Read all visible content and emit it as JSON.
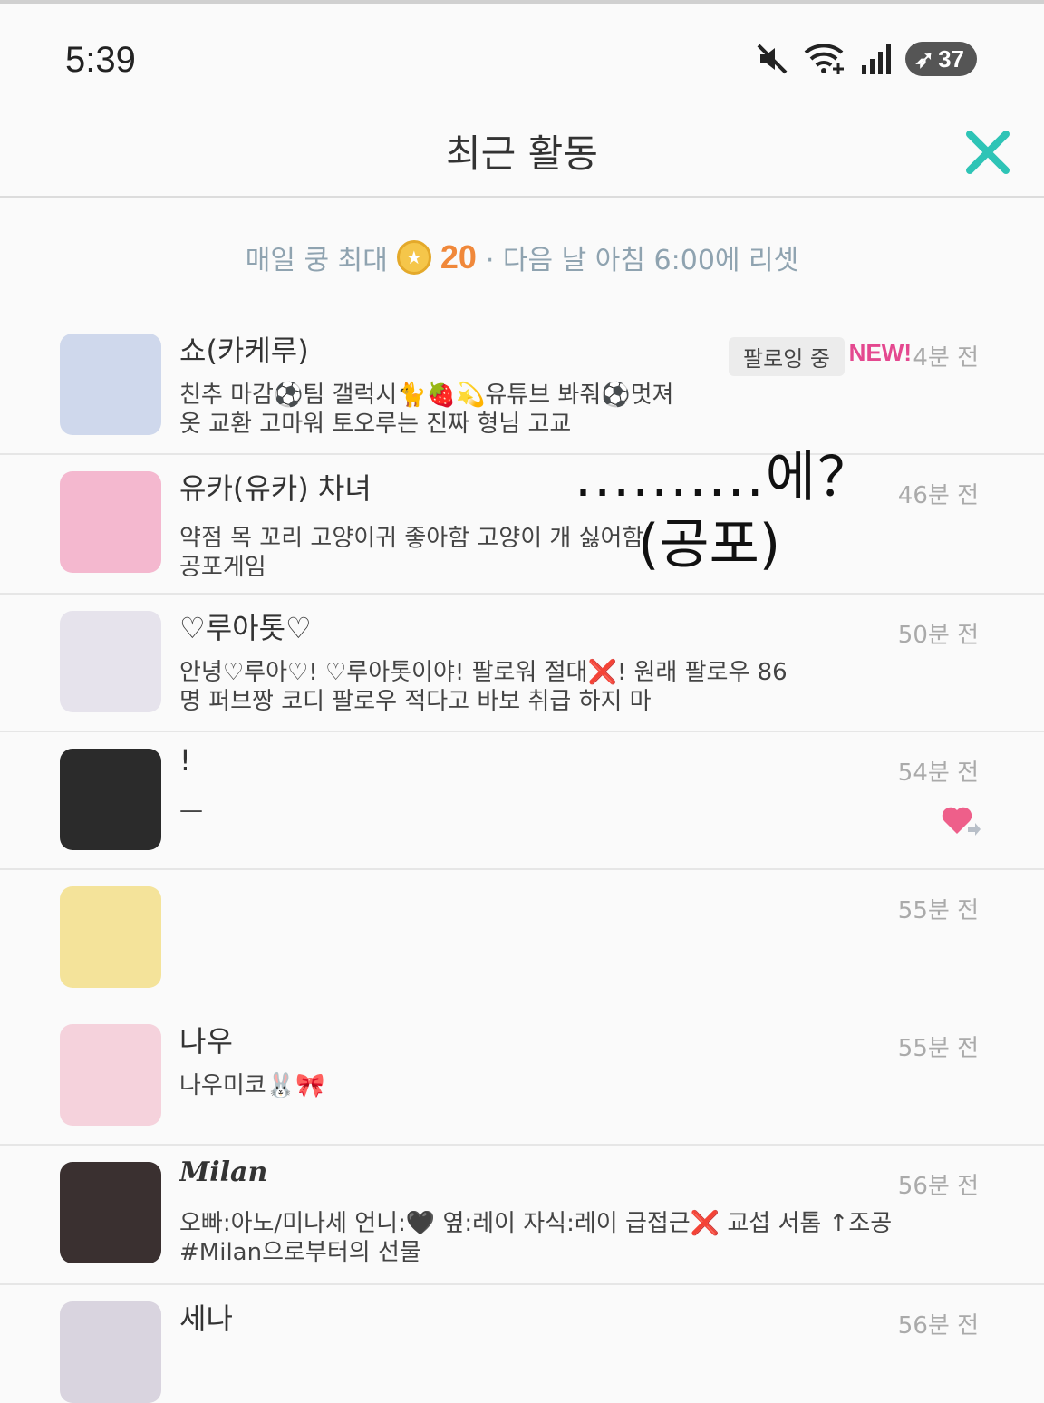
{
  "status_bar": {
    "time": "5:39",
    "battery": "37"
  },
  "header": {
    "title": "최근 활동"
  },
  "notice": {
    "prefix": "매일 쿵 최대",
    "count": "20",
    "suffix": "· 다음 날 아침 6:00에 리셋"
  },
  "overlay": {
    "line1": "..........에？",
    "line2": "(공포)"
  },
  "items": [
    {
      "name": "쇼(카케루)",
      "message": "친추 마감⚽팀 갤럭시🐈🍓💫유튜브 봐줘⚽멋져\n옷 교환 고마워 토오루는 진짜 형님 고교",
      "time": "4분 전",
      "badge": "팔로잉 중",
      "new": "NEW!",
      "avatar_color": "#cfd8ec"
    },
    {
      "name": "유카(유카) 차녀",
      "message": "약점 목 꼬리 고양이귀 좋아함 고양이 개 싫어함\n공포게임",
      "time": "46분 전",
      "avatar_color": "#f4b8cf"
    },
    {
      "name": "♡루아톳♡",
      "message": "안녕♡루아♡! ♡루아톳이야! 팔로워 절대❌! 원래 팔로우 86\n명 퍼브짱 코디 팔로우 적다고 바보 취급 하지 마",
      "time": "50분 전",
      "avatar_color": "#e6e3ec"
    },
    {
      "name": "!",
      "message": "—",
      "time": "54분 전",
      "avatar_color": "#2b2b2b"
    },
    {
      "name": "",
      "message": "",
      "time": "55분 전",
      "avatar_color": "#f4e39a"
    },
    {
      "name": "나우",
      "message": "나우미코🐰🎀",
      "time": "55분 전",
      "avatar_color": "#f5d2dc"
    },
    {
      "name": "Milan",
      "message": "오빠:아노/미나세 언니:🖤 옆:레이 자식:레이 급접근❌ 교섭 서톰 ↑조공\n#Milan으로부터의 선물",
      "time": "56분 전",
      "avatar_color": "#3a3030"
    },
    {
      "name": "세나",
      "message": "",
      "time": "56분 전",
      "avatar_color": "#d9d4df"
    }
  ],
  "colors": {
    "accent_close": "#2ec4b6",
    "new_badge": "#e4488f",
    "coin_count": "#f0883a"
  }
}
